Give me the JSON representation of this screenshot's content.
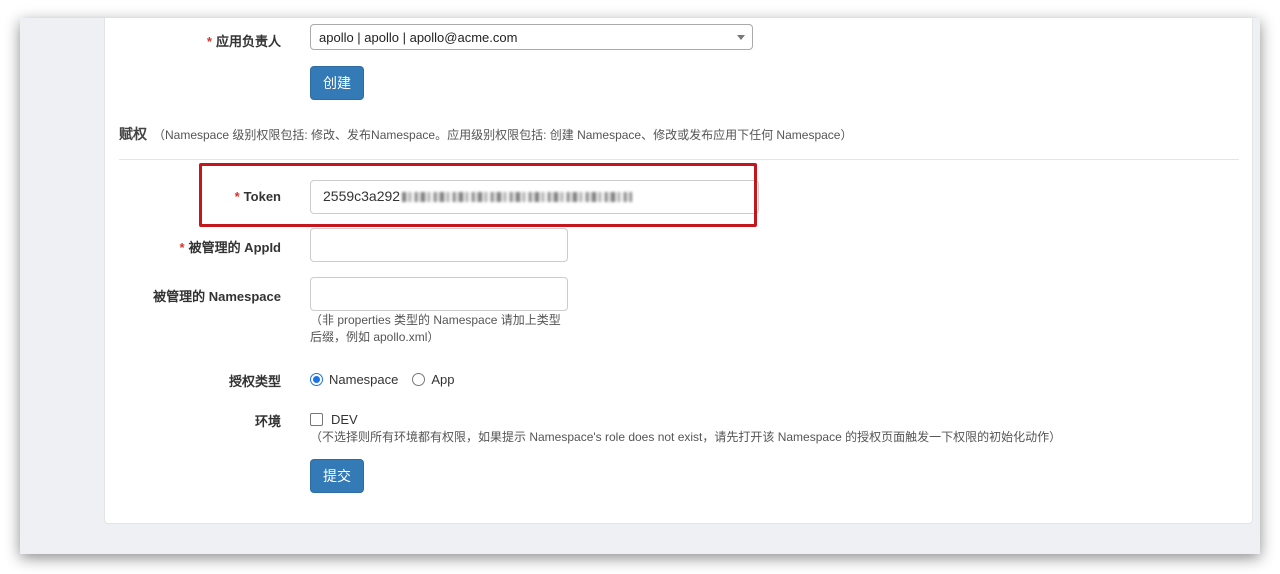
{
  "form": {
    "owner_label": "应用负责人",
    "owner_value": "apollo | apollo | apollo@acme.com",
    "create_button": "创建"
  },
  "section": {
    "title": "赋权",
    "hint": "（Namespace 级别权限包括: 修改、发布Namespace。应用级别权限包括: 创建 Namespace、修改或发布应用下任何 Namespace）"
  },
  "grant": {
    "token_label": "Token",
    "token_value": "2559c3a292",
    "appid_label": "被管理的 AppId",
    "appid_value": "",
    "namespace_label": "被管理的 Namespace",
    "namespace_value": "",
    "namespace_hint_line1": "（非 properties 类型的 Namespace 请加上类型",
    "namespace_hint_line2": "后缀，例如 apollo.xml）",
    "type_label": "授权类型",
    "type_options": [
      "Namespace",
      "App"
    ],
    "type_selected": "Namespace",
    "env_label": "环境",
    "env_options": [
      "DEV"
    ],
    "env_hint": "（不选择则所有环境都有权限，如果提示 Namespace's role does not exist，请先打开该 Namespace 的授权页面触发一下权限的初始化动作）",
    "submit_button": "提交"
  },
  "colors": {
    "primary_button": "#337ab7",
    "required_mark": "#d9312b",
    "highlight_box": "#c4161c",
    "radio_selected": "#1a73e8"
  }
}
